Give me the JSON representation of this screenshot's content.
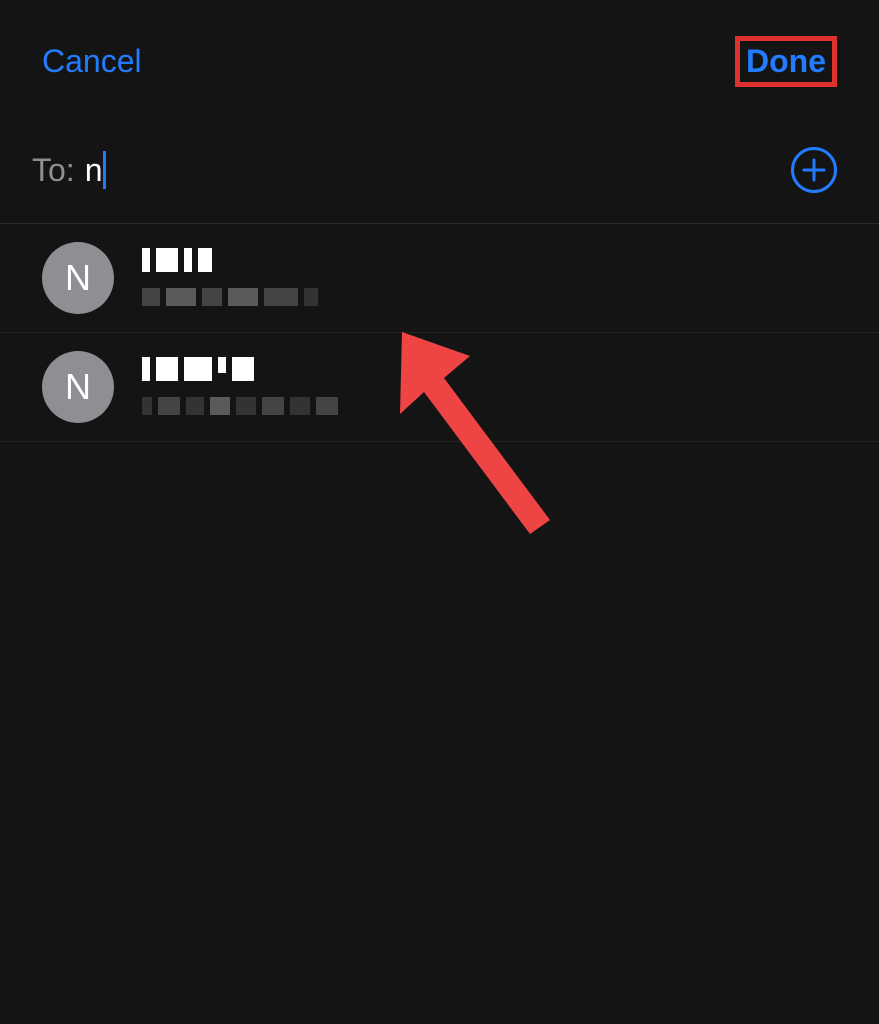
{
  "header": {
    "cancel_label": "Cancel",
    "done_label": "Done"
  },
  "to_field": {
    "label": "To:",
    "value": "n"
  },
  "results": [
    {
      "avatar_initial": "N"
    },
    {
      "avatar_initial": "N"
    }
  ],
  "colors": {
    "accent": "#237cff",
    "annotation": "#e03131",
    "background": "#141414"
  }
}
